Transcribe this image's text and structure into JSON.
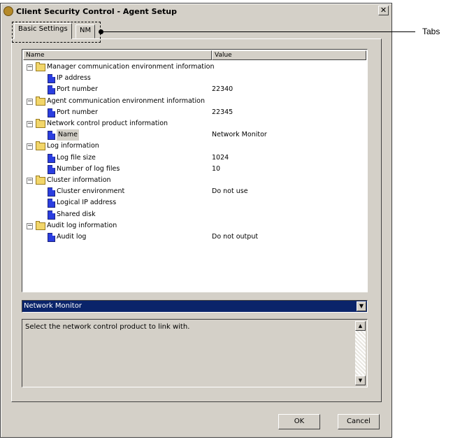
{
  "window": {
    "title": "Client Security Control - Agent Setup",
    "close_glyph": "✕"
  },
  "tabs": [
    {
      "label": "Basic Settings",
      "active": true
    },
    {
      "label": "NM",
      "active": false
    }
  ],
  "tree": {
    "headers": {
      "name": "Name",
      "value": "Value"
    },
    "groups": [
      {
        "label": "Manager communication environment information",
        "children": [
          {
            "label": "IP address",
            "value": ""
          },
          {
            "label": "Port number",
            "value": "22340"
          }
        ]
      },
      {
        "label": "Agent communication environment information",
        "children": [
          {
            "label": "Port number",
            "value": "22345"
          }
        ]
      },
      {
        "label": "Network control product information",
        "children": [
          {
            "label": "Name",
            "value": "Network Monitor"
          }
        ]
      },
      {
        "label": "Log information",
        "children": [
          {
            "label": "Log file size",
            "value": "1024"
          },
          {
            "label": "Number of log files",
            "value": "10"
          }
        ]
      },
      {
        "label": "Cluster information",
        "children": [
          {
            "label": "Cluster environment",
            "value": "Do not use"
          },
          {
            "label": "Logical IP address",
            "value": ""
          },
          {
            "label": "Shared disk",
            "value": ""
          }
        ]
      },
      {
        "label": "Audit log information",
        "children": [
          {
            "label": "Audit log",
            "value": "Do not output"
          }
        ]
      }
    ]
  },
  "dropdown": {
    "selected": "Network Monitor"
  },
  "description": {
    "text": "Select the network control product to link with."
  },
  "buttons": {
    "ok": "OK",
    "cancel": "Cancel"
  },
  "annotation": {
    "label": "Tabs"
  }
}
